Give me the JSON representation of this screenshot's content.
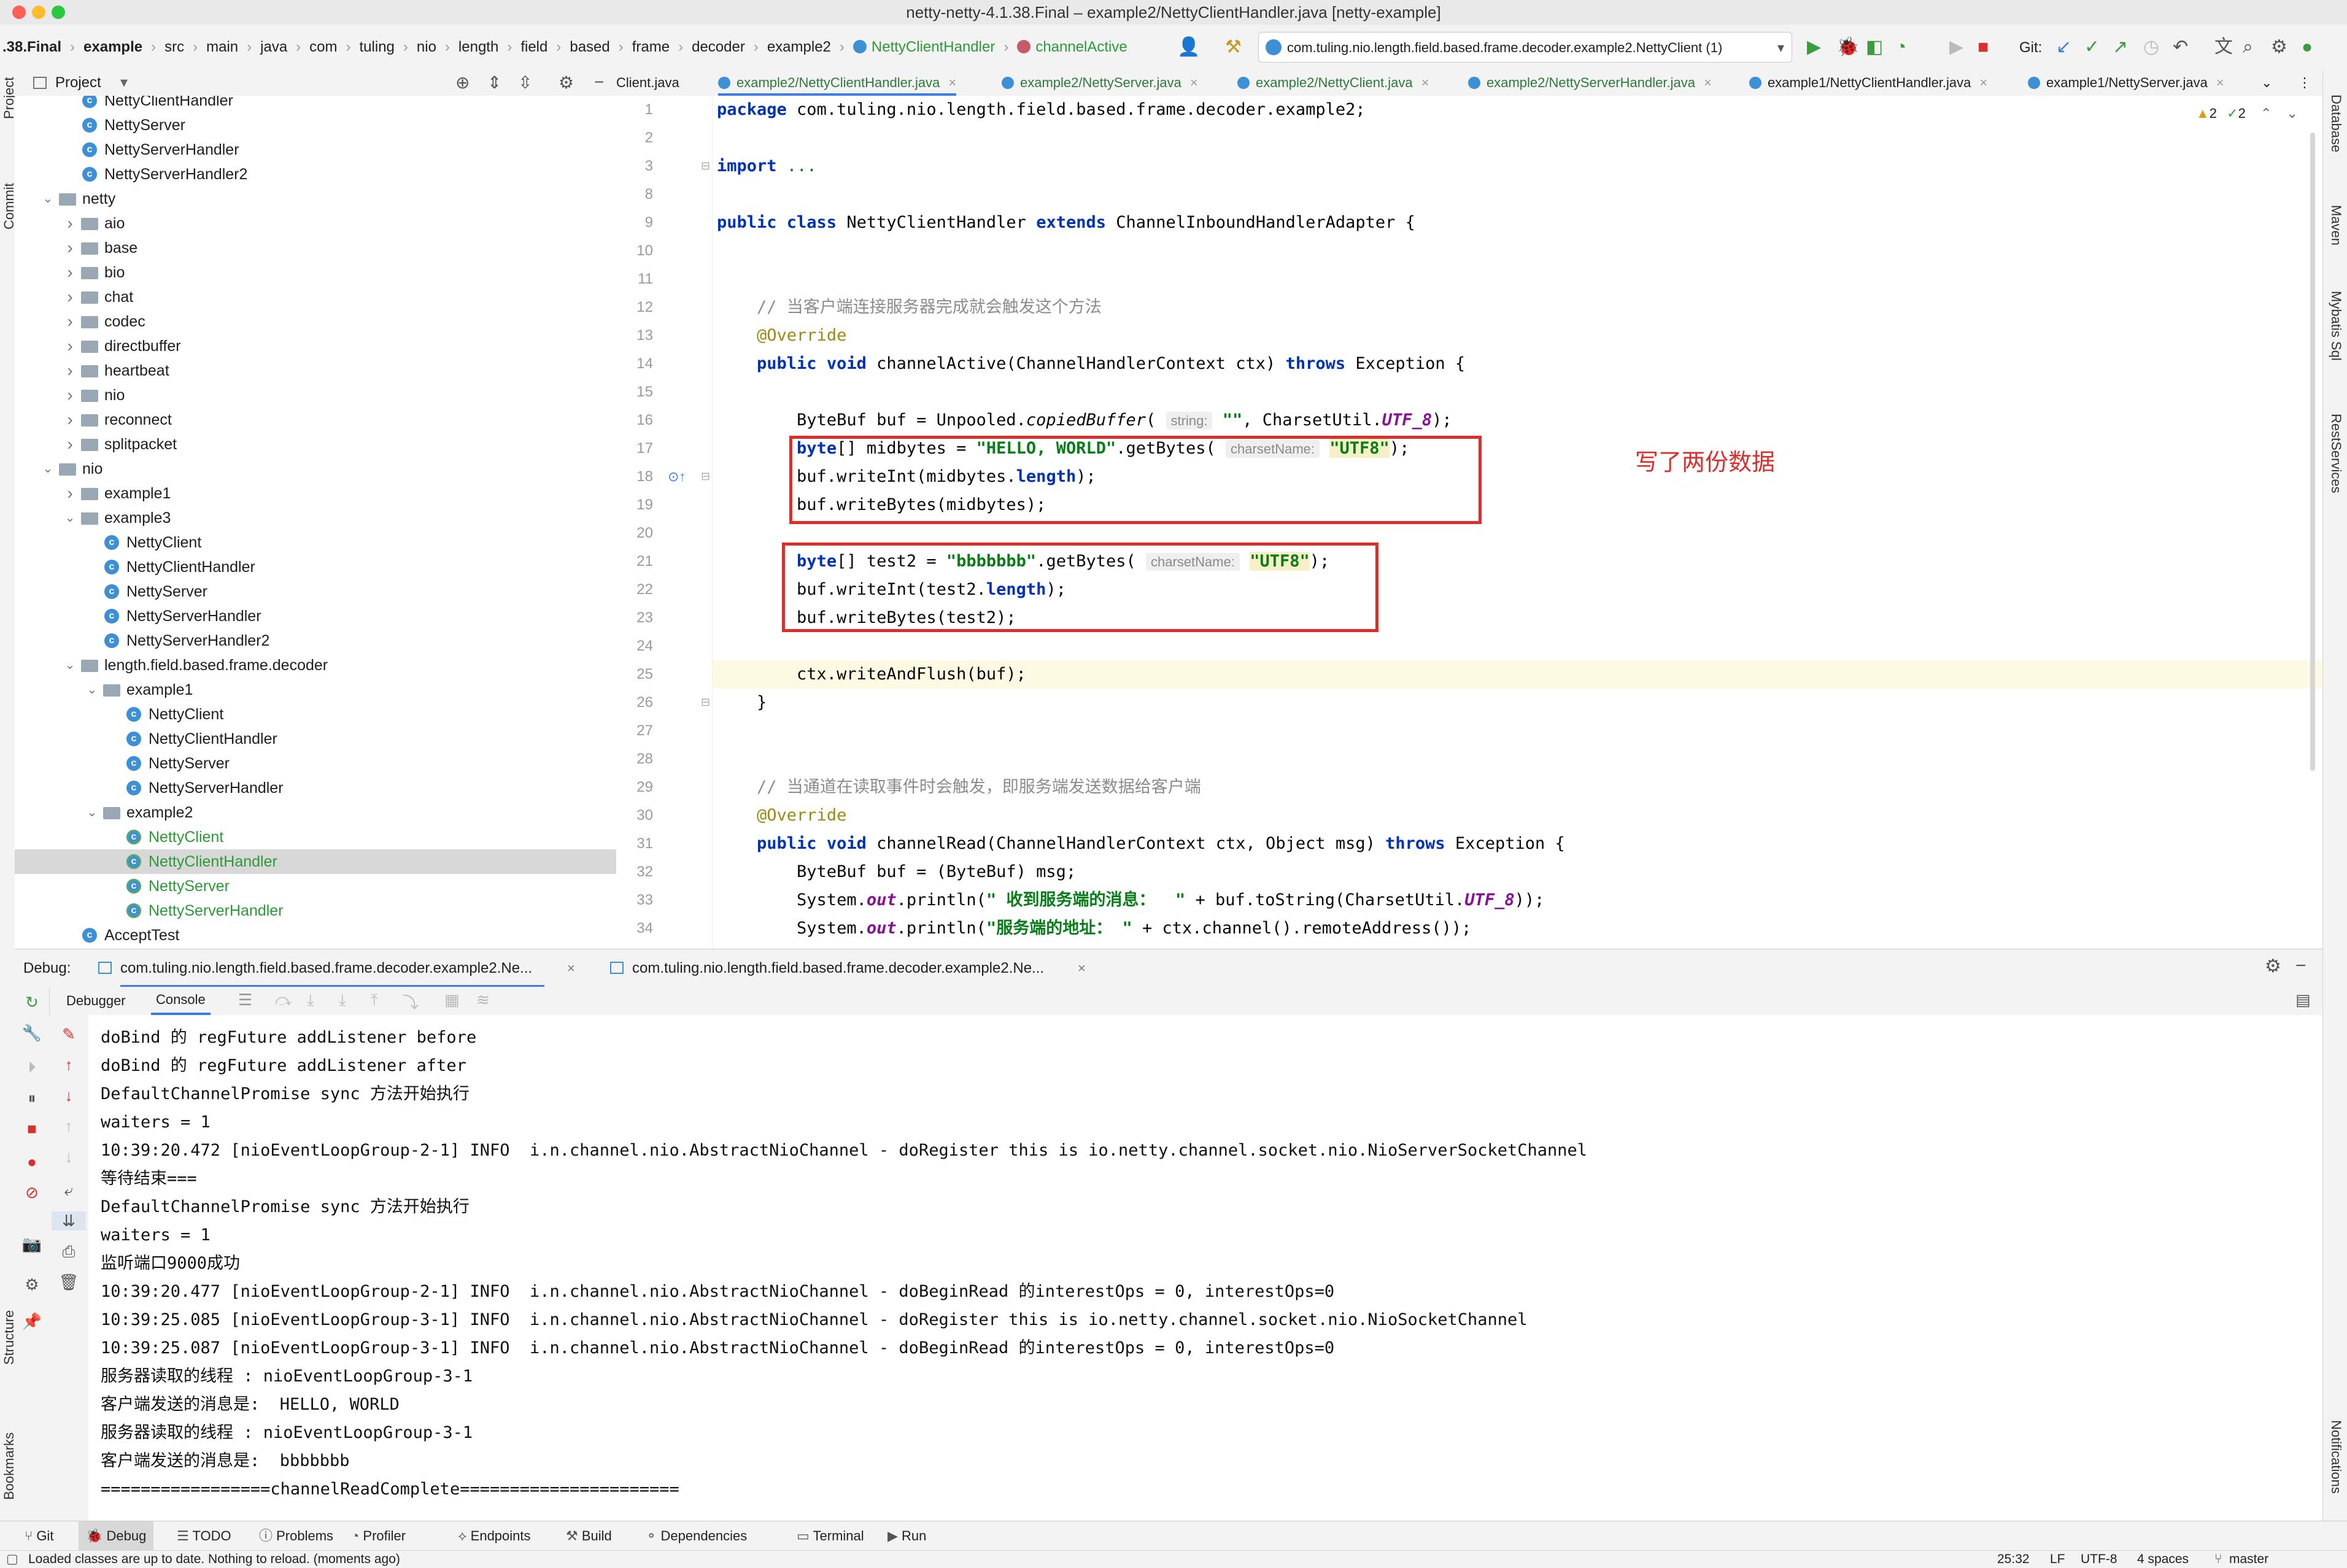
{
  "window": {
    "title": "netty-netty-4.1.38.Final – example2/NettyClientHandler.java [netty-example]"
  },
  "breadcrumbs": [
    ".38.Final",
    "example",
    "src",
    "main",
    "java",
    "com",
    "tuling",
    "nio",
    "length",
    "field",
    "based",
    "frame",
    "decoder",
    "example2",
    "NettyClientHandler",
    "channelActive"
  ],
  "toolbar": {
    "run_config": "com.tuling.nio.length.field.based.frame.decoder.example2.NettyClient (1)",
    "git_label": "Git:"
  },
  "project_panel": {
    "title": "Project"
  },
  "tree": [
    {
      "label": "NettyClientHandler",
      "type": "class",
      "depth": 3
    },
    {
      "label": "NettyServer",
      "type": "class",
      "depth": 3
    },
    {
      "label": "NettyServerHandler",
      "type": "class",
      "depth": 3
    },
    {
      "label": "NettyServerHandler2",
      "type": "class",
      "depth": 3
    },
    {
      "label": "netty",
      "type": "folder",
      "depth": 2,
      "open": true
    },
    {
      "label": "aio",
      "type": "folder",
      "depth": 3
    },
    {
      "label": "base",
      "type": "folder",
      "depth": 3
    },
    {
      "label": "bio",
      "type": "folder",
      "depth": 3
    },
    {
      "label": "chat",
      "type": "folder",
      "depth": 3
    },
    {
      "label": "codec",
      "type": "folder",
      "depth": 3
    },
    {
      "label": "directbuffer",
      "type": "folder",
      "depth": 3
    },
    {
      "label": "heartbeat",
      "type": "folder",
      "depth": 3
    },
    {
      "label": "nio",
      "type": "folder",
      "depth": 3
    },
    {
      "label": "reconnect",
      "type": "folder",
      "depth": 3
    },
    {
      "label": "splitpacket",
      "type": "folder",
      "depth": 3
    },
    {
      "label": "nio",
      "type": "folder",
      "depth": 2,
      "open": true
    },
    {
      "label": "example1",
      "type": "folder",
      "depth": 3
    },
    {
      "label": "example3",
      "type": "folder",
      "depth": 3,
      "open": true
    },
    {
      "label": "NettyClient",
      "type": "class",
      "depth": 4
    },
    {
      "label": "NettyClientHandler",
      "type": "class",
      "depth": 4
    },
    {
      "label": "NettyServer",
      "type": "class",
      "depth": 4
    },
    {
      "label": "NettyServerHandler",
      "type": "class",
      "depth": 4
    },
    {
      "label": "NettyServerHandler2",
      "type": "class",
      "depth": 4
    },
    {
      "label": "length.field.based.frame.decoder",
      "type": "folder",
      "depth": 3,
      "open": true
    },
    {
      "label": "example1",
      "type": "folder",
      "depth": 4,
      "open": true
    },
    {
      "label": "NettyClient",
      "type": "class",
      "depth": 5
    },
    {
      "label": "NettyClientHandler",
      "type": "class",
      "depth": 5
    },
    {
      "label": "NettyServer",
      "type": "class",
      "depth": 5
    },
    {
      "label": "NettyServerHandler",
      "type": "class",
      "depth": 5
    },
    {
      "label": "example2",
      "type": "folder",
      "depth": 4,
      "open": true
    },
    {
      "label": "NettyClient",
      "type": "class",
      "depth": 5,
      "modified": true
    },
    {
      "label": "NettyClientHandler",
      "type": "class",
      "depth": 5,
      "modified": true,
      "selected": true
    },
    {
      "label": "NettyServer",
      "type": "class",
      "depth": 5,
      "modified": true
    },
    {
      "label": "NettyServerHandler",
      "type": "class",
      "depth": 5,
      "modified": true
    },
    {
      "label": "AcceptTest",
      "type": "class",
      "depth": 3
    }
  ],
  "editor_tabs": [
    {
      "label": "Client.java"
    },
    {
      "label": "example2/NettyClientHandler.java",
      "active": true
    },
    {
      "label": "example2/NettyServer.java"
    },
    {
      "label": "example2/NettyClient.java"
    },
    {
      "label": "example2/NettyServerHandler.java"
    },
    {
      "label": "example1/NettyClientHandler.java"
    },
    {
      "label": "example1/NettyServer.java"
    }
  ],
  "inspections": {
    "warnings": "2",
    "ok": "2"
  },
  "code_lines": [
    {
      "n": "1",
      "html": "<span class='kw'>package</span> com.tuling.nio.length.field.based.frame.decoder.example2;"
    },
    {
      "n": "2",
      "html": ""
    },
    {
      "n": "3",
      "html": "<span class='kw'>import</span> <span class='str' style='font-weight:normal'>...</span>"
    },
    {
      "n": "8",
      "html": ""
    },
    {
      "n": "9",
      "html": "<span class='kw'>public class</span> NettyClientHandler <span class='kw'>extends</span> ChannelInboundHandlerAdapter {"
    },
    {
      "n": "10",
      "html": ""
    },
    {
      "n": "11",
      "html": ""
    },
    {
      "n": "12",
      "html": "    <span class='cmt'>// 当客户端连接服务器完成就会触发这个方法</span>"
    },
    {
      "n": "13",
      "html": "    <span class='ann'>@Override</span>"
    },
    {
      "n": "14",
      "html": "    <span class='kw'>public void</span> channelActive(ChannelHandlerContext ctx) <span class='kw'>throws</span> Exception {"
    },
    {
      "n": "15",
      "html": ""
    },
    {
      "n": "16",
      "html": "        ByteBuf buf = Unpooled.<span class='ital'>copiedBuffer</span>( <span class='hint'>string:</span> <span class='str'>\"\"</span>, CharsetUtil.<span class='stat'>UTF_8</span>);"
    },
    {
      "n": "17",
      "html": "        <span class='kw'>byte</span>[] midbytes = <span class='str'>\"HELLO, WORLD\"</span>.getBytes( <span class='hint'>charsetName:</span> <span class='str hstr'>\"UTF8\"</span>);"
    },
    {
      "n": "18",
      "html": "        buf.writeInt(midbytes.<span class='kw'>length</span>);"
    },
    {
      "n": "19",
      "html": "        buf.writeBytes(midbytes);"
    },
    {
      "n": "20",
      "html": ""
    },
    {
      "n": "21",
      "html": "        <span class='kw'>byte</span>[] test2 = <span class='str'>\"bbbbbbb\"</span>.getBytes( <span class='hint'>charsetName:</span> <span class='str hstr'>\"UTF8\"</span>);"
    },
    {
      "n": "22",
      "html": "        buf.writeInt(test2.<span class='kw'>length</span>);"
    },
    {
      "n": "23",
      "html": "        buf.writeBytes(test2);"
    },
    {
      "n": "24",
      "html": ""
    },
    {
      "n": "25",
      "html": "        ctx.writeAndFlush(buf);"
    },
    {
      "n": "26",
      "html": "    }"
    },
    {
      "n": "27",
      "html": ""
    },
    {
      "n": "28",
      "html": ""
    },
    {
      "n": "29",
      "html": "    <span class='cmt'>// 当通道在读取事件时会触发，即服务端发送数据给客户端</span>"
    },
    {
      "n": "30",
      "html": "    <span class='ann'>@Override</span>"
    },
    {
      "n": "31",
      "html": "    <span class='kw'>public void</span> channelRead(ChannelHandlerContext ctx, Object msg) <span class='kw'>throws</span> Exception {"
    },
    {
      "n": "32",
      "html": "        ByteBuf buf = (ByteBuf) msg;"
    },
    {
      "n": "33",
      "html": "        System.<span class='stat'>out</span>.println(<span class='str'>\" 收到服务端的消息：  \"</span> + buf.toString(CharsetUtil.<span class='stat'>UTF_8</span>));"
    },
    {
      "n": "34",
      "html": "        System.<span class='stat'>out</span>.println(<span class='str'>\"服务端的地址： \"</span> + ctx.channel().remoteAddress());"
    }
  ],
  "annotation_note": "写了两份数据",
  "debug": {
    "label": "Debug:",
    "session1": "com.tuling.nio.length.field.based.frame.decoder.example2.Ne...",
    "session2": "com.tuling.nio.length.field.based.frame.decoder.example2.Ne...",
    "tab_debugger": "Debugger",
    "tab_console": "Console"
  },
  "console_lines": [
    "doBind 的 regFuture addListener before",
    "doBind 的 regFuture addListener after",
    "DefaultChannelPromise sync 方法开始执行",
    "waiters = 1",
    "10:39:20.472 [nioEventLoopGroup-2-1] INFO  i.n.channel.nio.AbstractNioChannel - doRegister this is io.netty.channel.socket.nio.NioServerSocketChannel",
    "等待结束===",
    "DefaultChannelPromise sync 方法开始执行",
    "waiters = 1",
    "监听端口9000成功",
    "10:39:20.477 [nioEventLoopGroup-2-1] INFO  i.n.channel.nio.AbstractNioChannel - doBeginRead 的interestOps = 0, interestOps=0",
    "10:39:25.085 [nioEventLoopGroup-3-1] INFO  i.n.channel.nio.AbstractNioChannel - doRegister this is io.netty.channel.socket.nio.NioSocketChannel",
    "10:39:25.087 [nioEventLoopGroup-3-1] INFO  i.n.channel.nio.AbstractNioChannel - doBeginRead 的interestOps = 0, interestOps=0",
    "服务器读取的线程 : nioEventLoopGroup-3-1",
    "客户端发送的消息是:  HELLO, WORLD",
    "服务器读取的线程 : nioEventLoopGroup-3-1",
    "客户端发送的消息是:  bbbbbbb",
    "=================channelReadComplete======================"
  ],
  "tool_windows": [
    "Git",
    "Debug",
    "TODO",
    "Problems",
    "Profiler",
    "Endpoints",
    "Build",
    "Dependencies",
    "Terminal",
    "Run"
  ],
  "status": {
    "message": "Loaded classes are up to date. Nothing to reload. (moments ago)",
    "position": "25:32",
    "line_sep": "LF",
    "encoding": "UTF-8",
    "indent": "4 spaces",
    "branch": "master"
  },
  "right_strip": [
    "Database",
    "Maven",
    "Mybatis Sql",
    "RestServices",
    "Notifications"
  ],
  "left_strip": [
    "Project",
    "Commit",
    "Structure",
    "Bookmarks"
  ]
}
